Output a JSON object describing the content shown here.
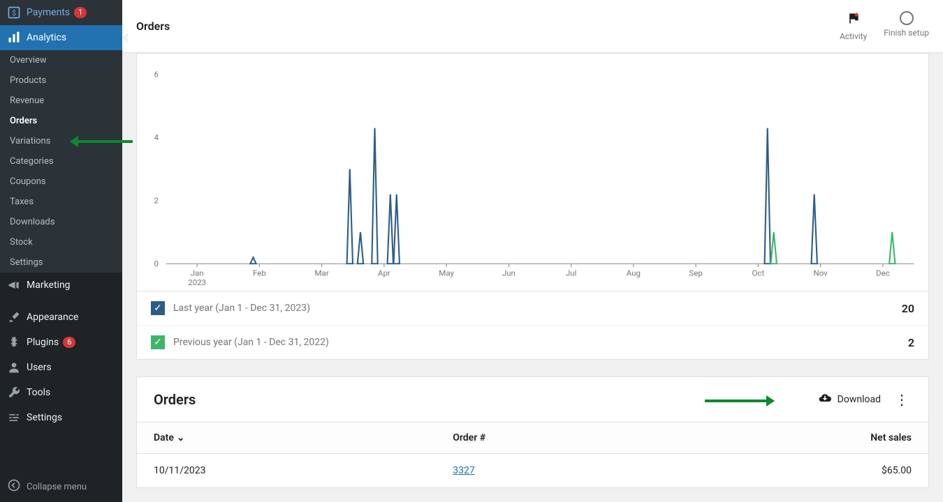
{
  "sidebar": {
    "payments": {
      "label": "Payments",
      "badge": "1"
    },
    "analytics": {
      "label": "Analytics"
    },
    "analytics_sub": [
      "Overview",
      "Products",
      "Revenue",
      "Orders",
      "Variations",
      "Categories",
      "Coupons",
      "Taxes",
      "Downloads",
      "Stock",
      "Settings"
    ],
    "marketing": {
      "label": "Marketing"
    },
    "appearance": {
      "label": "Appearance"
    },
    "plugins": {
      "label": "Plugins",
      "badge": "6"
    },
    "users": {
      "label": "Users"
    },
    "tools": {
      "label": "Tools"
    },
    "settings": {
      "label": "Settings"
    },
    "collapse": {
      "label": "Collapse menu"
    }
  },
  "topbar": {
    "title": "Orders",
    "activity": "Activity",
    "finish": "Finish setup"
  },
  "legend": {
    "series": [
      {
        "label": "Last year (Jan 1 - Dec 31, 2023)",
        "value": "20",
        "color": "#2c5d88"
      },
      {
        "label": "Previous year (Jan 1 - Dec 31, 2022)",
        "value": "2",
        "color": "#3db66b"
      }
    ]
  },
  "orders_card": {
    "title": "Orders",
    "download": "Download",
    "columns": {
      "date": "Date",
      "order": "Order #",
      "net": "Net sales"
    },
    "rows": [
      {
        "date": "10/11/2023",
        "order": "3327",
        "net": "$65.00"
      }
    ]
  },
  "chart_data": {
    "type": "line",
    "xlabel_bottom": "2023",
    "categories": [
      "Jan",
      "Feb",
      "Mar",
      "Apr",
      "May",
      "Jun",
      "Jul",
      "Aug",
      "Sep",
      "Oct",
      "Nov",
      "Dec"
    ],
    "y_ticks": [
      0,
      2,
      4,
      6
    ],
    "ylim": [
      0,
      6
    ],
    "series": [
      {
        "name": "Last year (Jan 1 - Dec 31, 2023)",
        "color": "#2c5d88",
        "points": [
          {
            "x": 1.4,
            "y": 0.2
          },
          {
            "x": 2.95,
            "y": 3.0
          },
          {
            "x": 3.12,
            "y": 1.0
          },
          {
            "x": 3.35,
            "y": 4.3
          },
          {
            "x": 3.6,
            "y": 2.2
          },
          {
            "x": 3.7,
            "y": 2.2
          },
          {
            "x": 9.65,
            "y": 4.3
          },
          {
            "x": 10.4,
            "y": 2.2
          }
        ]
      },
      {
        "name": "Previous year (Jan 1 - Dec 31, 2022)",
        "color": "#3db66b",
        "points": [
          {
            "x": 9.75,
            "y": 1.0
          },
          {
            "x": 11.65,
            "y": 1.0
          }
        ]
      }
    ]
  }
}
